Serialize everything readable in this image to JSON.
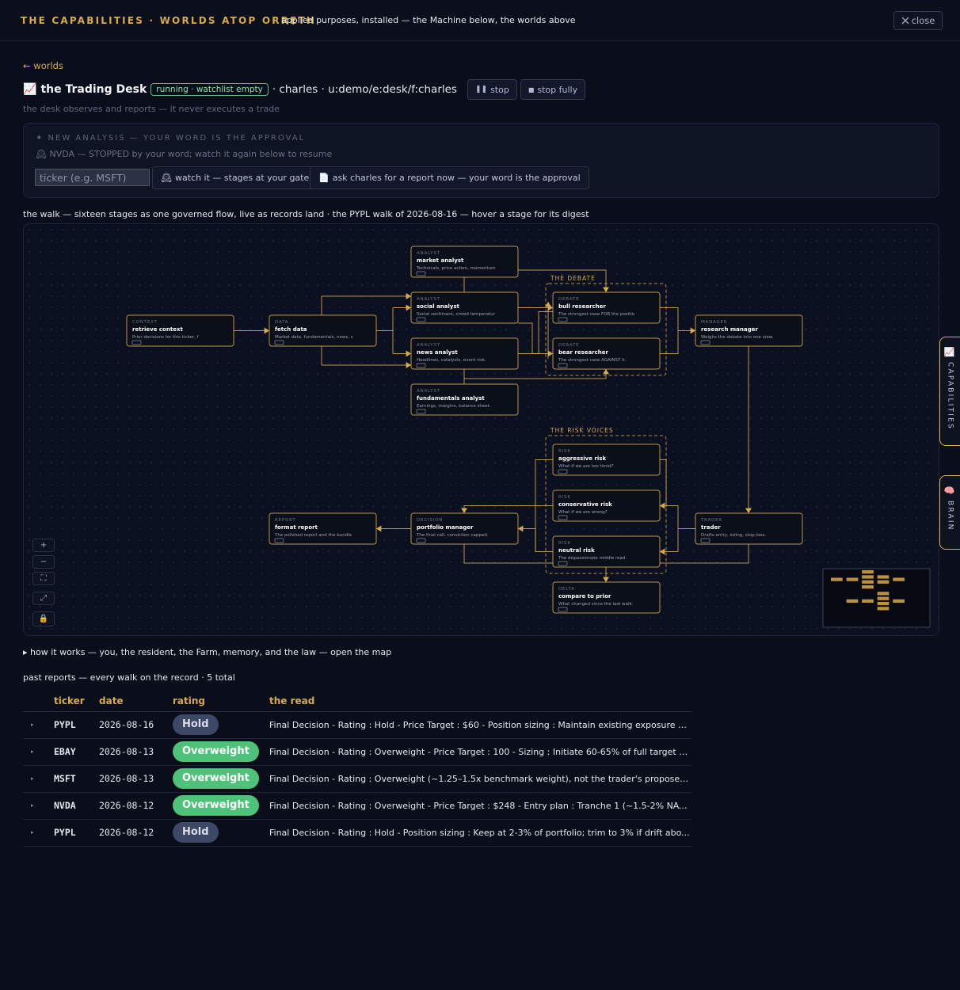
{
  "topbar": {
    "brand": "THE CAPABILITIES · WORLDS ATOP ORRETH",
    "subtitle": "applied purposes, installed — the Machine below, the worlds above",
    "close_label": "close"
  },
  "nav": {
    "back_label": "worlds"
  },
  "desk": {
    "emoji": "📈",
    "title": "the Trading Desk",
    "status": "running · watchlist empty",
    "owner": "· charles · u:demo/e:desk/f:charles",
    "stop_label": "stop",
    "stop_fully_label": "stop fully",
    "subline": "the desk observes and reports — it never executes a trade"
  },
  "analysis": {
    "heading": "✦ NEW ANALYSIS — YOUR WORD IS THE APPROVAL",
    "status": "NVDA — STOPPED by your word; watch it again below to resume",
    "ticker_placeholder": "ticker (e.g. MSFT)",
    "watch_label": "watch it — stages at your gate",
    "ask_label": "ask charles for a report now — your word is the approval"
  },
  "walk": {
    "caption": "the walk — sixteen stages as one governed flow, live as records land · the PYPL walk of 2026-08-16 — hover a stage for its digest",
    "group_debate": "THE DEBATE",
    "group_risk": "THE RISK VOICES",
    "stages": [
      {
        "id": "retrieve",
        "kind": "CONTEXT",
        "name": "retrieve context",
        "desc": "Prior decisions for this ticker, f"
      },
      {
        "id": "fetch",
        "kind": "DATA",
        "name": "fetch data",
        "desc": "Market data, fundamentals, news, s"
      },
      {
        "id": "market",
        "kind": "ANALYST",
        "name": "market analyst",
        "desc": "Technicals, price action, momentum"
      },
      {
        "id": "social",
        "kind": "ANALYST",
        "name": "social analyst",
        "desc": "Social sentiment, crowd temperatur"
      },
      {
        "id": "news",
        "kind": "ANALYST",
        "name": "news analyst",
        "desc": "Headlines, catalysts, event risk."
      },
      {
        "id": "fundamentals",
        "kind": "ANALYST",
        "name": "fundamentals analyst",
        "desc": "Earnings, margins, balance sheet."
      },
      {
        "id": "bull",
        "kind": "DEBATE",
        "name": "bull researcher",
        "desc": "The strongest case FOR the positio"
      },
      {
        "id": "bear",
        "kind": "DEBATE",
        "name": "bear researcher",
        "desc": "The strongest case AGAINST it."
      },
      {
        "id": "manager",
        "kind": "MANAGER",
        "name": "research manager",
        "desc": "Weighs the debate into one view."
      },
      {
        "id": "aggressive",
        "kind": "RISK",
        "name": "aggressive risk",
        "desc": "What if we are too timid?"
      },
      {
        "id": "conservative",
        "kind": "RISK",
        "name": "conservative risk",
        "desc": "What if we are wrong?"
      },
      {
        "id": "neutral",
        "kind": "RISK",
        "name": "neutral risk",
        "desc": "The dispassionate middle read."
      },
      {
        "id": "trader",
        "kind": "TRADER",
        "name": "trader",
        "desc": "Drafts entry, sizing, stop-loss."
      },
      {
        "id": "portfolio",
        "kind": "DECISION",
        "name": "portfolio manager",
        "desc": "The final call, conviction capped."
      },
      {
        "id": "report",
        "kind": "REPORT",
        "name": "format report",
        "desc": "The polished report and the bundle"
      },
      {
        "id": "delta",
        "kind": "DELTA",
        "name": "compare to prior",
        "desc": "What changed since the last walk."
      }
    ]
  },
  "howit": "▸ how it works — you, the resident, the Farm, memory, and the law — open the map",
  "past": {
    "caption": "past reports — every walk on the record · 5 total",
    "headers": [
      "ticker",
      "date",
      "rating",
      "the read"
    ],
    "rows": [
      {
        "ticker": "PYPL",
        "date": "2026-08-16",
        "rating": "Hold",
        "read": "Final Decision - Rating : Hold - Price Target : $60 - Position sizing : Maintain existing exposure a..."
      },
      {
        "ticker": "EBAY",
        "date": "2026-08-13",
        "rating": "Overweight",
        "read": "Final Decision - Rating : Overweight - Price Target : 100 - Sizing : Initiate 60-65% of full target n..."
      },
      {
        "ticker": "MSFT",
        "date": "2026-08-13",
        "rating": "Overweight",
        "read": "Final Decision - Rating : Overweight (~1.25–1.5x benchmark weight), not the trader's proposed ..."
      },
      {
        "ticker": "NVDA",
        "date": "2026-08-12",
        "rating": "Overweight",
        "read": "Final Decision - Rating : Overweight - Price Target : $248 - Entry plan : Tranche 1 (~1.5-2% NAV..."
      },
      {
        "ticker": "PYPL",
        "date": "2026-08-12",
        "rating": "Hold",
        "read": "Final Decision - Rating : Hold - Position sizing : Keep at 2-3% of portfolio; trim to 3% if drift abo..."
      }
    ]
  },
  "side_tabs": {
    "capabilities": "CAPABILITIES",
    "brain": "BRAIN"
  },
  "colors": {
    "accent": "#d9a94a",
    "hold": "#3d4766",
    "overweight": "#4fc27a"
  }
}
